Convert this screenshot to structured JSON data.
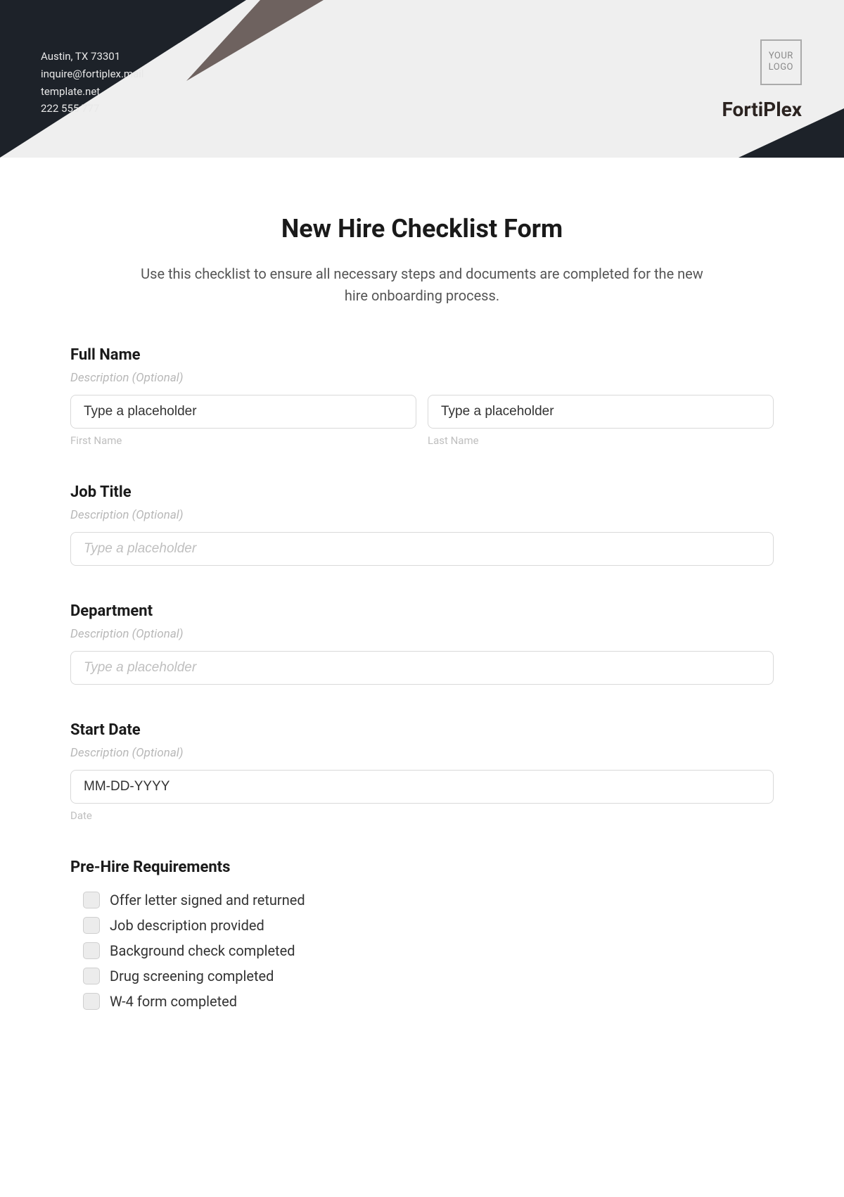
{
  "header": {
    "contact": {
      "address": "Austin, TX 73301",
      "email": "inquire@fortiplex.mail",
      "website": "template.net",
      "phone": "222 555 777"
    },
    "logo_text": "YOUR\nLOGO",
    "brand": "FortiPlex"
  },
  "form": {
    "title": "New Hire Checklist Form",
    "description": "Use this checklist to ensure all necessary steps and documents are completed for the new hire onboarding process."
  },
  "fields": {
    "full_name": {
      "label": "Full Name",
      "sub": "Description (Optional)",
      "first_placeholder": "Type a placeholder",
      "last_placeholder": "Type a placeholder",
      "first_under": "First Name",
      "last_under": "Last Name"
    },
    "job_title": {
      "label": "Job Title",
      "sub": "Description (Optional)",
      "placeholder": "Type a placeholder"
    },
    "department": {
      "label": "Department",
      "sub": "Description (Optional)",
      "placeholder": "Type a placeholder"
    },
    "start_date": {
      "label": "Start Date",
      "sub": "Description (Optional)",
      "placeholder": "MM-DD-YYYY",
      "under": "Date"
    }
  },
  "prehire": {
    "title": "Pre-Hire Requirements",
    "items": [
      "Offer letter signed and returned",
      "Job description provided",
      "Background check completed",
      "Drug screening completed",
      "W-4 form completed"
    ]
  }
}
